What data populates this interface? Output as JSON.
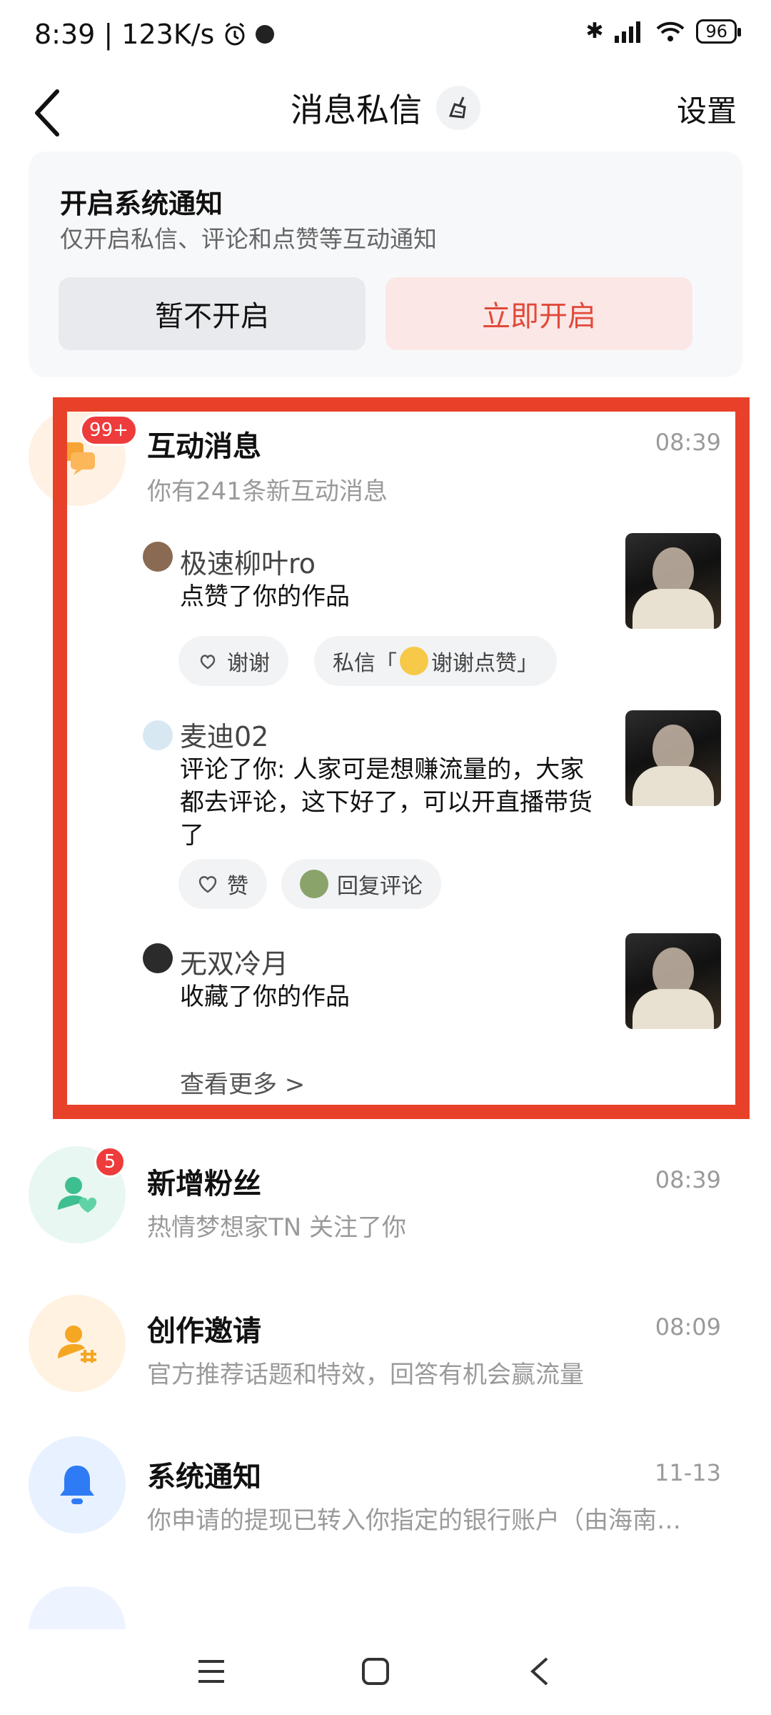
{
  "status_bar": {
    "left_text": "8:39 | 123K/s",
    "battery": "96"
  },
  "header": {
    "title": "消息私信",
    "settings_label": "设置"
  },
  "notification_card": {
    "title": "开启系统通知",
    "subtitle": "仅开启私信、评论和点赞等互动通知",
    "later_label": "暂不开启",
    "enable_label": "立即开启"
  },
  "interactions": {
    "title": "互动消息",
    "badge": "99+",
    "time": "08:39",
    "subtitle": "你有241条新互动消息",
    "items": [
      {
        "name": "极速柳叶ro",
        "text": "点赞了你的作品",
        "chips": [
          "谢谢",
          "私信「",
          "谢谢点赞」"
        ]
      },
      {
        "name": "麦迪02",
        "text": "评论了你: 人家可是想赚流量的，大家都去评论，这下好了，可以开直播带货了",
        "chips": [
          "赞",
          "回复评论"
        ]
      },
      {
        "name": "无双冷月",
        "text": "收藏了你的作品"
      }
    ],
    "see_more": "查看更多 >"
  },
  "rows": [
    {
      "title": "新增粉丝",
      "badge": "5",
      "time": "08:39",
      "subtitle": "热情梦想家TN 关注了你",
      "icon": "person-heart-icon",
      "color": "#3ebf8f"
    },
    {
      "title": "创作邀请",
      "time": "08:09",
      "subtitle": "官方推荐话题和特效，回答有机会赢流量",
      "icon": "person-hash-icon",
      "color": "#f5a623"
    },
    {
      "title": "系统通知",
      "time": "11-13",
      "subtitle": "你申请的提现已转入你指定的银行账户（由海南…",
      "icon": "bell-icon",
      "color": "#2f7bf6"
    }
  ],
  "colors": {
    "highlight": "#e8412a",
    "accent_red": "#e04a3a"
  }
}
